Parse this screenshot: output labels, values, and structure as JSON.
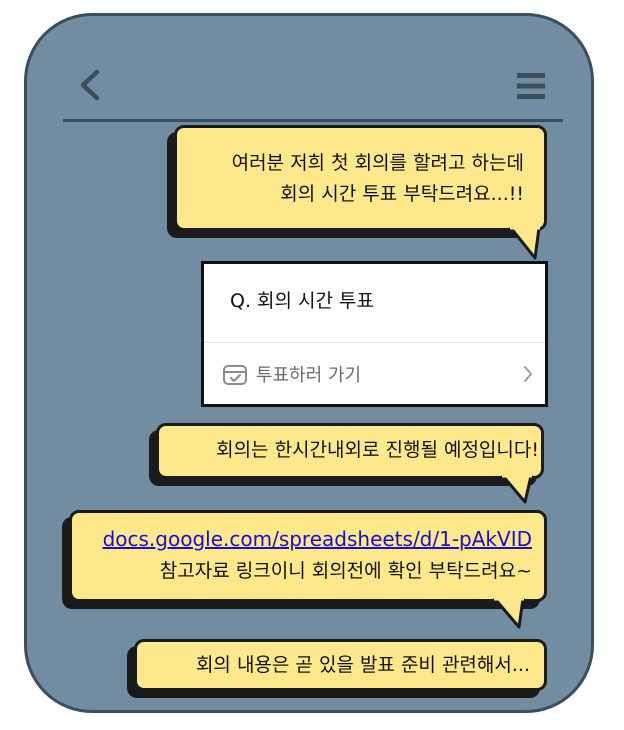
{
  "messages": [
    {
      "lines": [
        "여러분 저희 첫 회의를 할려고 하는데",
        "회의 시간 투표 부탁드려요...!!"
      ]
    },
    {
      "text": "회의는 한시간내외로 진행될 예정입니다!"
    },
    {
      "link": "docs.google.com/spreadsheets/d/1-pAkVID",
      "text": "참고자료 링크이니 회의전에 확인 부탁드려요~"
    },
    {
      "text": "회의 내용은 곧 있을 발표 준비 관련해서..."
    }
  ],
  "poll": {
    "question": "Q. 회의 시간 투표",
    "action_label": "투표하러 가기"
  },
  "icons": {
    "back": "back-arrow-icon",
    "menu": "hamburger-menu-icon",
    "vote": "ballot-box-icon",
    "chevron": "chevron-right-icon"
  },
  "colors": {
    "background": "#728ca1",
    "frame": "#3d4e5b",
    "bubble": "#fde98b",
    "link": "#1a0dd7"
  }
}
